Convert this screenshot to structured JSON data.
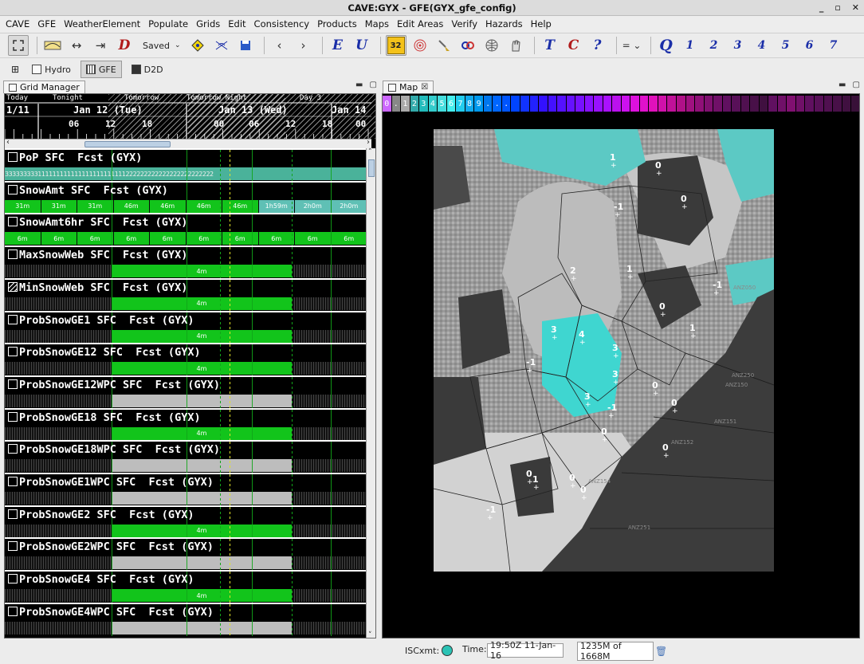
{
  "window": {
    "title": "CAVE:GYX - GFE(GYX_gfe_config)",
    "controls": [
      "_",
      "▫",
      "✕"
    ]
  },
  "menu": [
    "CAVE",
    "GFE",
    "WeatherElement",
    "Populate",
    "Grids",
    "Edit",
    "Consistency",
    "Products",
    "Maps",
    "Edit Areas",
    "Verify",
    "Hazards",
    "Help"
  ],
  "toolbar": {
    "saved_label": "Saved",
    "letters": {
      "e": "E",
      "u": "U",
      "t": "T",
      "c": "C",
      "q": "Q",
      "help": "?",
      "d": "D",
      "badge": "32"
    },
    "numbers": [
      "1",
      "2",
      "3",
      "4",
      "5",
      "6",
      "7"
    ]
  },
  "perspectives": [
    {
      "label": "Hydro",
      "active": false
    },
    {
      "label": "GFE",
      "active": true
    },
    {
      "label": "D2D",
      "active": false
    }
  ],
  "grid_manager": {
    "tab_label": "Grid Manager",
    "timescale": {
      "periods": [
        "Today",
        "Tonight",
        "Tomorrow",
        "Tomorrow Night",
        "Day 3"
      ],
      "dates": [
        "1/11",
        "Jan 12 (Tue)",
        "Jan 13 (Wed)",
        "Jan 14"
      ],
      "hours": [
        "06",
        "12",
        "18",
        "00",
        "06",
        "12",
        "18",
        "00",
        "06"
      ]
    },
    "rows": [
      {
        "label": "PoP SFC  Fcst (GYX)",
        "type": "pop",
        "values": "333333333111111111111111111111111222222222222222222222222"
      },
      {
        "label": "SnowAmt SFC  Fcst (GYX)",
        "type": "snowamt",
        "cells": [
          "31m",
          "31m",
          "31m",
          "46m",
          "46m",
          "46m",
          "46m",
          "1h59m",
          "2h0m",
          "2h0m"
        ]
      },
      {
        "label": "SnowAmt6hr SFC  Fcst (GYX)",
        "type": "six",
        "cells": [
          "6m",
          "6m",
          "6m",
          "6m",
          "6m",
          "6m",
          "6m",
          "6m",
          "6m",
          "6m"
        ]
      },
      {
        "label": "MaxSnowWeb SFC  Fcst (GYX)",
        "type": "green",
        "cell": "4m"
      },
      {
        "label": "MinSnowWeb SFC  Fcst (GYX)",
        "type": "green",
        "cell": "4m",
        "hatched": true
      },
      {
        "label": "ProbSnowGE1 SFC  Fcst (GYX)",
        "type": "green",
        "cell": "4m"
      },
      {
        "label": "ProbSnowGE12 SFC  Fcst (GYX)",
        "type": "green",
        "cell": "4m"
      },
      {
        "label": "ProbSnowGE12WPC SFC  Fcst (GYX)",
        "type": "gray",
        "cell": ""
      },
      {
        "label": "ProbSnowGE18 SFC  Fcst (GYX)",
        "type": "green",
        "cell": "4m"
      },
      {
        "label": "ProbSnowGE18WPC SFC  Fcst (GYX)",
        "type": "gray",
        "cell": ""
      },
      {
        "label": "ProbSnowGE1WPC SFC  Fcst (GYX)",
        "type": "gray",
        "cell": ""
      },
      {
        "label": "ProbSnowGE2 SFC  Fcst (GYX)",
        "type": "green",
        "cell": "4m"
      },
      {
        "label": "ProbSnowGE2WPC SFC  Fcst (GYX)",
        "type": "gray",
        "cell": ""
      },
      {
        "label": "ProbSnowGE4 SFC  Fcst (GYX)",
        "type": "green",
        "cell": "4m"
      },
      {
        "label": "ProbSnowGE4WPC SFC  Fcst (GYX)",
        "type": "gray",
        "cell": ""
      }
    ]
  },
  "map": {
    "tab_label": "Map",
    "colorbar": {
      "labels": [
        "0",
        ".",
        "1",
        "2",
        "3",
        "4",
        "5",
        "6",
        "7",
        "8",
        "9",
        ".",
        ".",
        ".",
        "",
        "",
        "",
        "",
        "",
        "",
        "",
        "",
        "",
        "",
        "",
        "",
        "",
        "",
        "",
        "",
        "",
        "",
        "",
        "",
        "",
        "",
        "",
        "",
        "",
        "",
        "",
        "",
        "",
        "",
        "",
        "",
        "",
        "",
        "",
        "",
        "",
        ""
      ],
      "colors": [
        "#cc66ff",
        "#888888",
        "#aaaaaa",
        "#33aaaa",
        "#22bbbb",
        "#33cccc",
        "#44dddd",
        "#44eeee",
        "#22ccee",
        "#11aaee",
        "#0099ee",
        "#0077ee",
        "#0066ff",
        "#0055ff",
        "#0044ff",
        "#1133ff",
        "#2222ff",
        "#3311ff",
        "#4411ff",
        "#5511ff",
        "#6611ff",
        "#7711ff",
        "#8811ff",
        "#9911ff",
        "#aa11ff",
        "#bb11ee",
        "#cc11ee",
        "#dd11dd",
        "#e011cc",
        "#e011bb",
        "#d011aa",
        "#c01199",
        "#b01188",
        "#a01180",
        "#901078",
        "#801070",
        "#701068",
        "#601060",
        "#581058",
        "#501050",
        "#481048",
        "#401040",
        "#601060",
        "#701068",
        "#801070",
        "#701068",
        "#601060",
        "#581058",
        "#501050",
        "#481048",
        "#401040",
        "#381038"
      ]
    },
    "labels": [
      {
        "text": "1"
      },
      {
        "text": "0"
      },
      {
        "text": "0"
      },
      {
        "text": "-1"
      },
      {
        "text": "2"
      },
      {
        "text": "1"
      },
      {
        "text": "-1"
      },
      {
        "text": "0"
      },
      {
        "text": "3"
      },
      {
        "text": "4"
      },
      {
        "text": "3"
      },
      {
        "text": "1"
      },
      {
        "text": "-1"
      },
      {
        "text": "3"
      },
      {
        "text": "0"
      },
      {
        "text": "0"
      },
      {
        "text": "3"
      },
      {
        "text": "-1"
      },
      {
        "text": "0"
      },
      {
        "text": "0"
      },
      {
        "text": "0"
      },
      {
        "text": "0"
      },
      {
        "text": "0"
      },
      {
        "text": "-1"
      },
      {
        "text": "1"
      }
    ],
    "zone_labels": [
      "ANZ050",
      "ANZ150",
      "ANZ151",
      "ANZ250",
      "ANZ152",
      "ANZ154",
      "ANZ251"
    ]
  },
  "statusbar": {
    "isc_label": "ISCxmt:",
    "time_label": "Time:",
    "time_value": "19:50Z 11-Jan-16",
    "memory": "1235M of 1668M"
  }
}
